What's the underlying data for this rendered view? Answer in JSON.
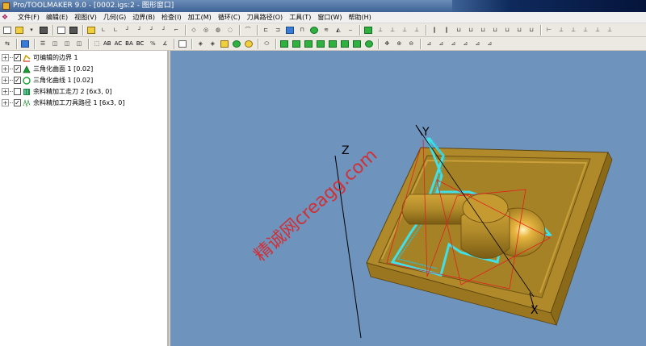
{
  "window": {
    "title": "Pro/TOOLMAKER 9.0 - [0002.igs:2 - 图形窗口]"
  },
  "menu": {
    "items": [
      "文件(F)",
      "编辑(E)",
      "视图(V)",
      "几何(G)",
      "边界(B)",
      "检查(I)",
      "加工(M)",
      "循环(C)",
      "刀具路径(O)",
      "工具(T)",
      "窗口(W)",
      "帮助(H)"
    ]
  },
  "toolbar2": {
    "labels": [
      "AB",
      "AC",
      "BA",
      "BC"
    ]
  },
  "tree": {
    "items": [
      {
        "label": "可编辑的边界 1",
        "checked": true,
        "icon": "editable-boundary-icon"
      },
      {
        "label": "三角化曲面 1 [0.02]",
        "checked": true,
        "icon": "triangulated-surface-icon"
      },
      {
        "label": "三角化曲线 1 [0.02]",
        "checked": true,
        "icon": "triangulated-curve-icon"
      },
      {
        "label": "余料精加工走刀 2 [6x3, 0]",
        "checked": false,
        "icon": "rest-finish-pass-icon"
      },
      {
        "label": "余料精加工刀具路径 1 [6x3, 0]",
        "checked": true,
        "icon": "rest-finish-toolpath-icon"
      }
    ]
  },
  "viewport": {
    "axes": {
      "x": "X",
      "y": "Y",
      "z": "Z"
    },
    "watermark": "精诚网creagg.com",
    "colors": {
      "background": "#6e93bd",
      "part": "#b08a2a",
      "toolpath_cyan": "#3fe0e8",
      "toolpath_red": "#e02020",
      "watermark": "#e02020"
    }
  }
}
